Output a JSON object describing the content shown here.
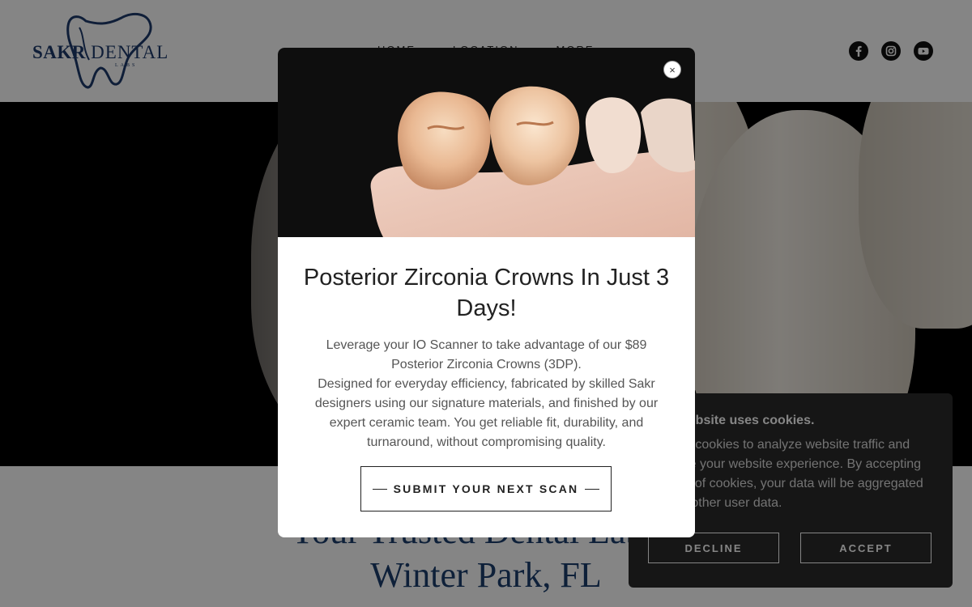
{
  "brand": {
    "name_part1": "SAKR",
    "name_part2": "DENTAL",
    "tagline_small": "LABS"
  },
  "nav": {
    "items": [
      {
        "label": "HOME"
      },
      {
        "label": "LOCATION"
      },
      {
        "label": "MORE"
      }
    ]
  },
  "socials": [
    {
      "icon": "facebook-icon"
    },
    {
      "icon": "instagram-icon"
    },
    {
      "icon": "youtube-icon"
    }
  ],
  "page": {
    "headline": "Your Trusted Dental Lab In Winter Park, FL"
  },
  "cookie_banner": {
    "title": "This website uses cookies.",
    "text": "We use cookies to analyze website traffic and optimize your website experience. By accepting our use of cookies, your data will be aggregated with all other user data.",
    "decline_label": "DECLINE",
    "accept_label": "ACCEPT"
  },
  "modal": {
    "close_label": "×",
    "title": "Posterior Zirconia Crowns In Just 3 Days!",
    "paragraph1": "Leverage your IO Scanner to take advantage of our $89 Posterior Zirconia Crowns (3DP).",
    "paragraph2": "Designed for everyday efficiency, fabricated by skilled Sakr designers using our signature materials, and finished by our expert ceramic team. You get reliable fit, durability, and turnaround, without compromising quality.",
    "cta_label": "SUBMIT YOUR NEXT SCAN"
  },
  "colors": {
    "brand_blue": "#1d3a6b",
    "overlay": "rgba(0,0,0,0.48)",
    "cookie_bg": "#2b2b2b"
  }
}
